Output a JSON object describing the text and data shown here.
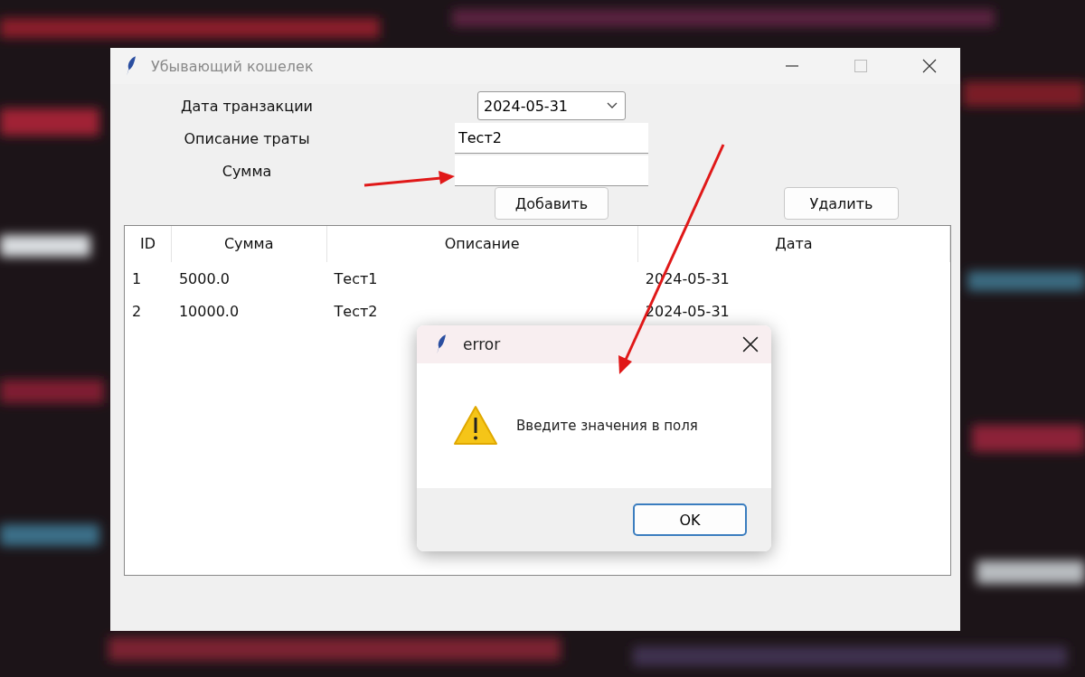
{
  "window": {
    "title": "Убывающий кошелек"
  },
  "form": [
    {
      "kind": "date",
      "label": "Дата транзакции",
      "value": "2024-05-31"
    },
    {
      "kind": "text",
      "label": "Описание траты",
      "value": "Тест2"
    },
    {
      "kind": "text",
      "label": "Сумма"
    }
  ],
  "buttons": {
    "add": "Добавить",
    "delete": "Удалить"
  },
  "table": {
    "columns": [
      "ID",
      "Сумма",
      "Описание",
      "Дата"
    ],
    "rows": [
      [
        "1",
        "5000.0",
        "Тест1",
        "2024-05-31"
      ],
      [
        "2",
        "10000.0",
        "Тест2",
        "2024-05-31"
      ]
    ]
  },
  "dialog": {
    "title": "error",
    "message": "Введите значения в поля",
    "button": "OK"
  }
}
